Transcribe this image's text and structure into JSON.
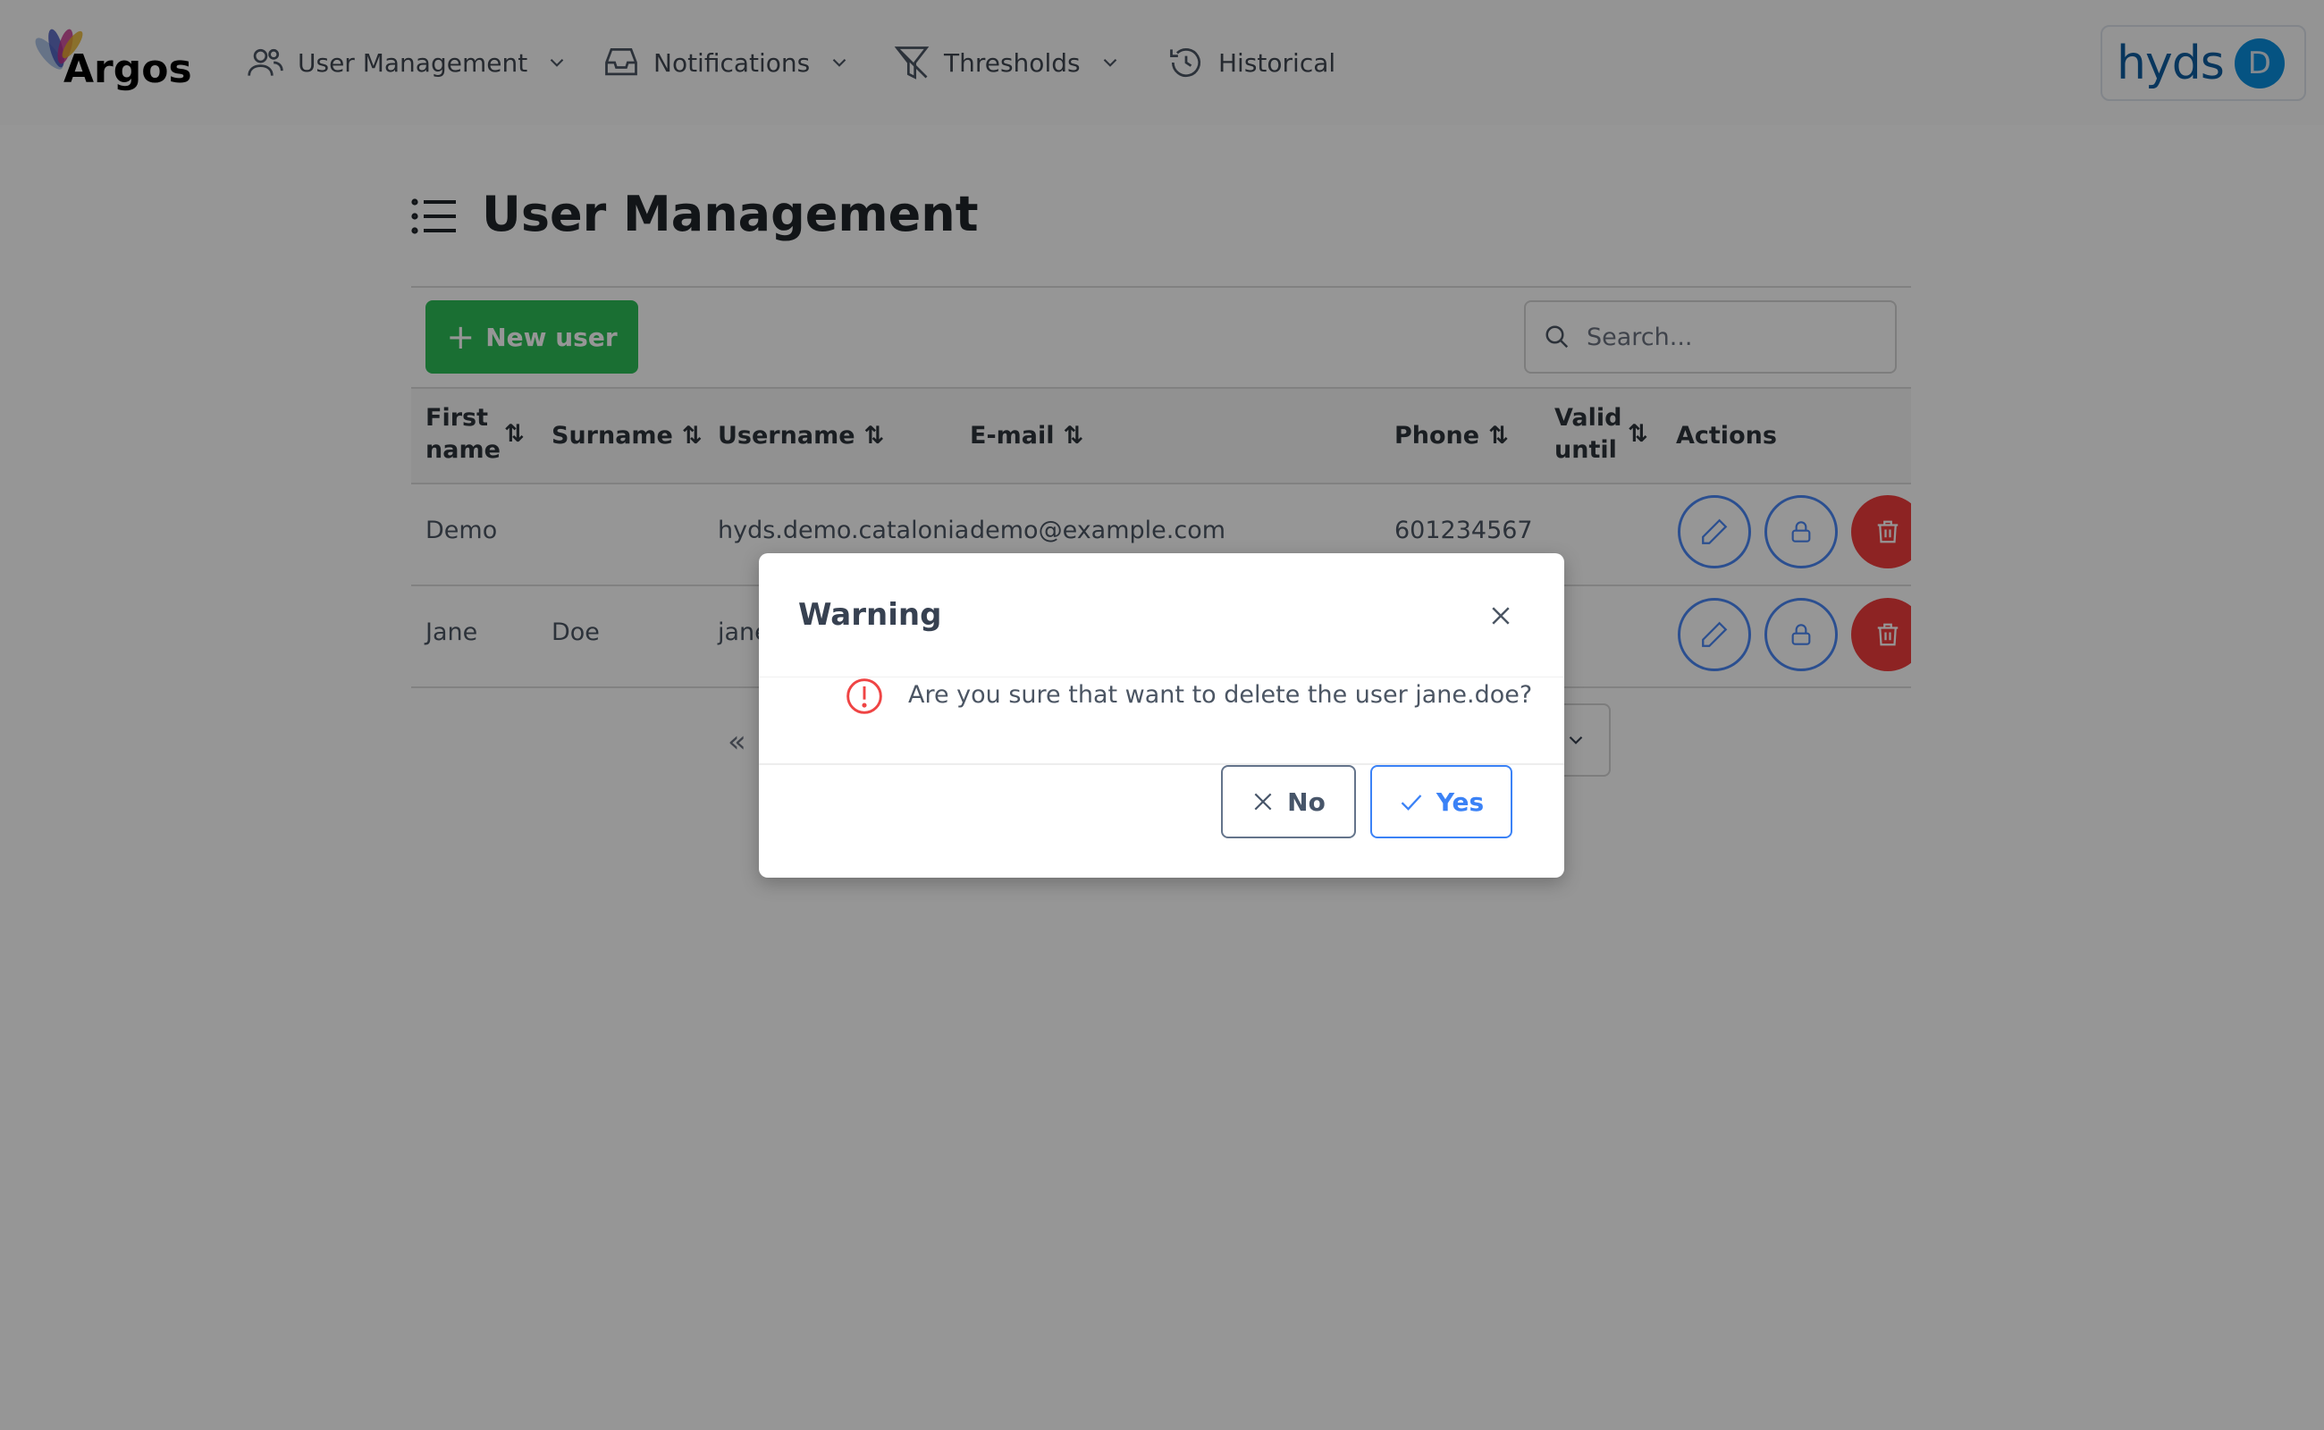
{
  "app": {
    "logo_text": "Argos",
    "brand_logo_text": "hyds",
    "avatar_initial": "D"
  },
  "nav": [
    {
      "label": "User Management",
      "icon": "users-icon",
      "has_dropdown": true
    },
    {
      "label": "Notifications",
      "icon": "inbox-icon",
      "has_dropdown": true
    },
    {
      "label": "Thresholds",
      "icon": "filter-icon",
      "has_dropdown": true
    },
    {
      "label": "Historical",
      "icon": "history-icon",
      "has_dropdown": false
    }
  ],
  "page": {
    "title": "User Management",
    "new_user_label": "New user",
    "search_placeholder": "Search..."
  },
  "table": {
    "columns": [
      "First name",
      "Surname",
      "Username",
      "E-mail",
      "Phone",
      "Valid until",
      "Actions"
    ],
    "rows": [
      {
        "first_name": "Demo",
        "surname": "",
        "username": "hyds.demo.catalonia",
        "email": "demo@example.com",
        "phone": "601234567",
        "valid_until": ""
      },
      {
        "first_name": "Jane",
        "surname": "Doe",
        "username": "jane",
        "email": "",
        "phone": "",
        "valid_until": ""
      }
    ]
  },
  "pagination": {
    "first_icon": "double-chevron-left-icon"
  },
  "dialog": {
    "title": "Warning",
    "message": "Are you sure that want to delete the user jane.doe?",
    "no_label": "No",
    "yes_label": "Yes"
  },
  "colors": {
    "primary": "#3b82f6",
    "success": "#2dbd58",
    "danger": "#f03c3c",
    "warning_icon": "#ef4444"
  }
}
